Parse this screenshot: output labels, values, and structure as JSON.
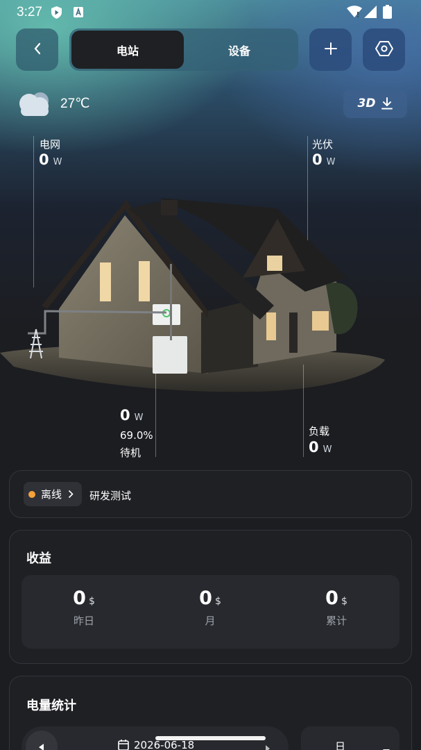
{
  "status_bar": {
    "time": "3:27",
    "icons": [
      "shield-play-icon",
      "text-a-icon",
      "wifi-icon",
      "signal-icon",
      "battery-icon"
    ]
  },
  "nav": {
    "back_icon": "chevron-left-icon",
    "tabs": [
      {
        "label": "电站",
        "active": true
      },
      {
        "label": "设备",
        "active": false
      }
    ],
    "add_icon": "plus-icon",
    "settings_icon": "hexagon-gear-icon"
  },
  "weather": {
    "icon": "cloud-icon",
    "temperature": "27℃"
  },
  "view_3d": {
    "label": "3D",
    "icon": "download-icon"
  },
  "energy_flow": {
    "grid": {
      "label": "电网",
      "value": "0",
      "unit": "W"
    },
    "pv": {
      "label": "光伏",
      "value": "0",
      "unit": "W"
    },
    "battery": {
      "value": "0",
      "unit": "W",
      "soc": "69.0%",
      "state": "待机"
    },
    "load": {
      "label": "负载",
      "value": "0",
      "unit": "W"
    }
  },
  "station_status": {
    "status": "离线",
    "status_color": "#f7a13a",
    "station_name": "研发测试"
  },
  "earnings": {
    "title": "收益",
    "items": [
      {
        "value": "0",
        "unit": "$",
        "label": "昨日"
      },
      {
        "value": "0",
        "unit": "$",
        "label": "月"
      },
      {
        "value": "0",
        "unit": "$",
        "label": "累计"
      }
    ]
  },
  "energy_stats": {
    "title": "电量统计",
    "date": "2026-06-18",
    "period": "日"
  },
  "colors": {
    "accent_green": "#68c4b2",
    "accent_blue": "#2c4e7d",
    "card_bg": "#1f2024",
    "offline_orange": "#f7a13a"
  }
}
